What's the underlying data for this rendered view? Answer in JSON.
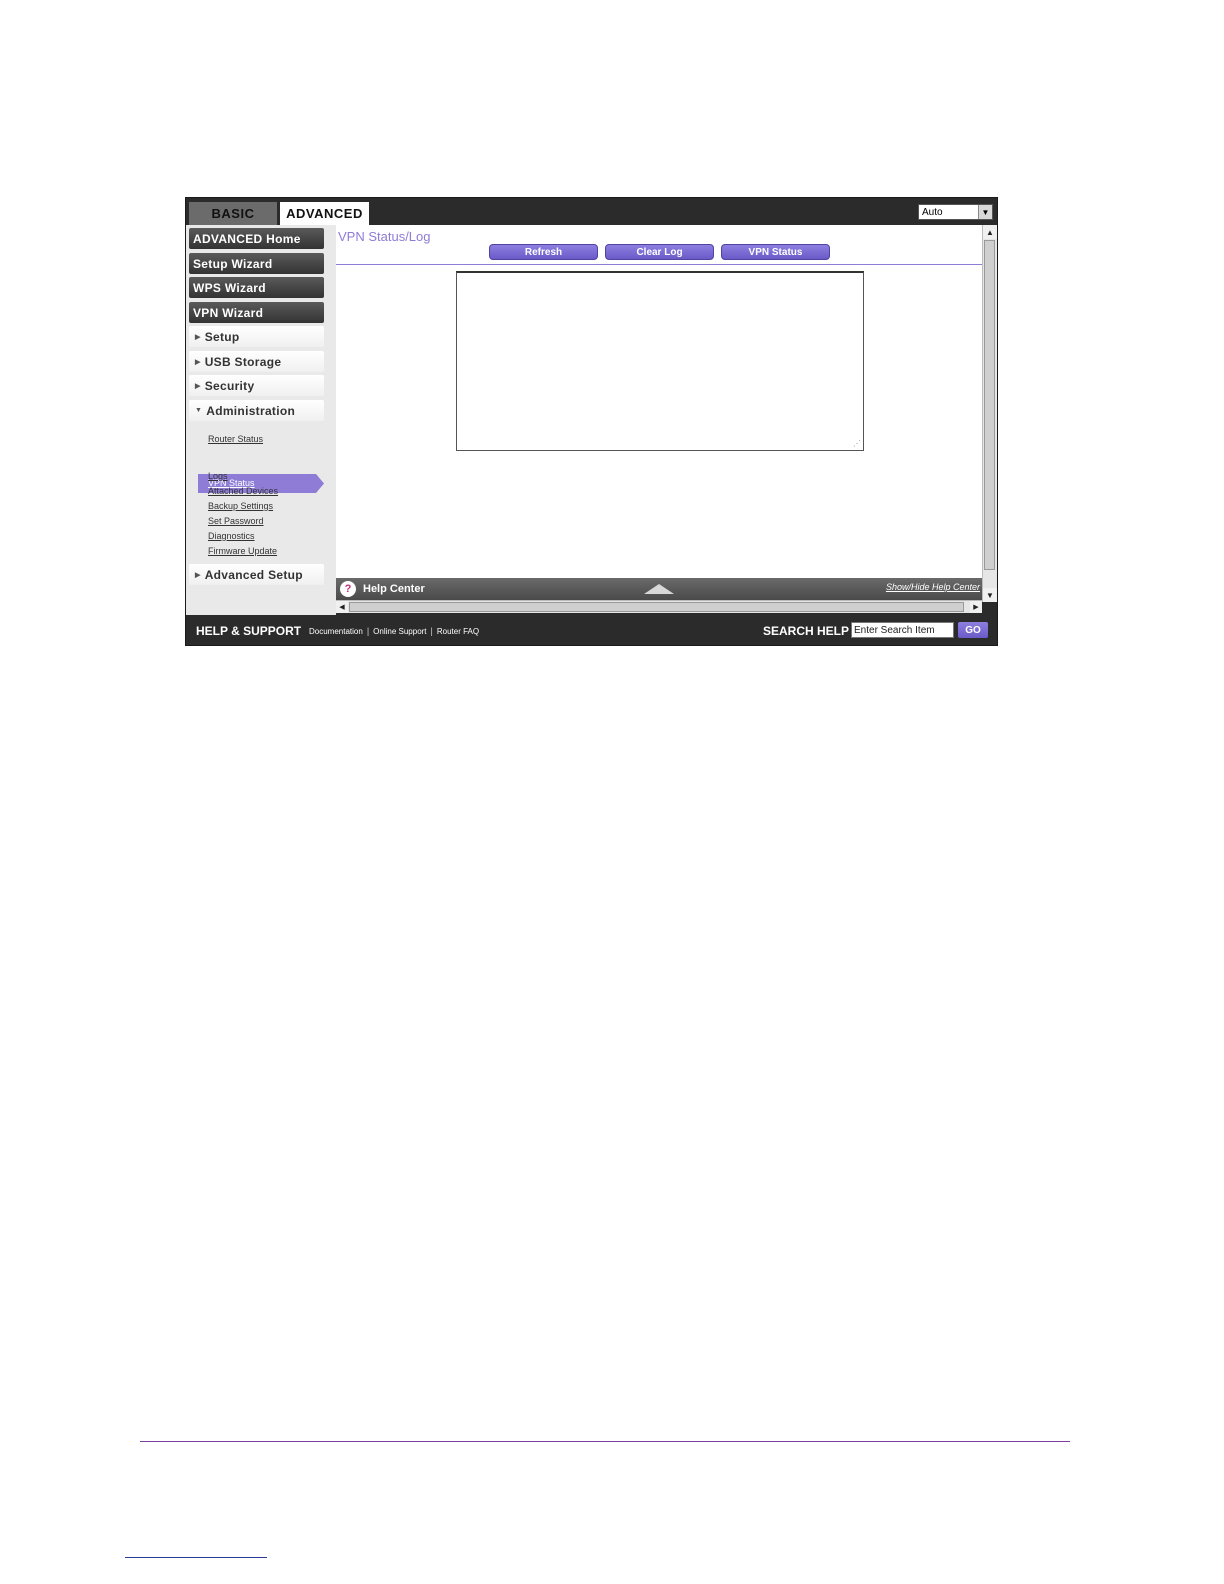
{
  "tabs": {
    "basic": "BASIC",
    "advanced": "ADVANCED"
  },
  "language_select": {
    "value": "Auto"
  },
  "sidebar": {
    "dark_items": [
      "ADVANCED Home",
      "Setup Wizard",
      "WPS Wizard",
      "VPN Wizard"
    ],
    "sections": [
      "Setup",
      "USB Storage",
      "Security",
      "Administration",
      "Advanced Setup"
    ],
    "admin_links": [
      "Router Status",
      "VPN Status",
      "Logs",
      "Attached Devices",
      "Backup Settings",
      "Set Password",
      "Diagnostics",
      "Firmware Update"
    ],
    "active_link": "VPN Status"
  },
  "main": {
    "title": "VPN Status/Log",
    "buttons": {
      "refresh": "Refresh",
      "clear_log": "Clear Log",
      "vpn_status": "VPN Status"
    },
    "log_text": ""
  },
  "help_center": {
    "title": "Help Center",
    "toggle": "Show/Hide Help Center",
    "icon": "question-icon"
  },
  "footer": {
    "title": "HELP & SUPPORT",
    "links": [
      "Documentation",
      "Online Support",
      "Router FAQ"
    ],
    "search_label": "SEARCH HELP",
    "search_value": "Enter Search Item",
    "go_label": "GO"
  },
  "colors": {
    "accent": "#8e7cd6",
    "button": "#6a5ac8",
    "chrome": "#2b2b2b",
    "page_rule": "#7b3fa0"
  }
}
